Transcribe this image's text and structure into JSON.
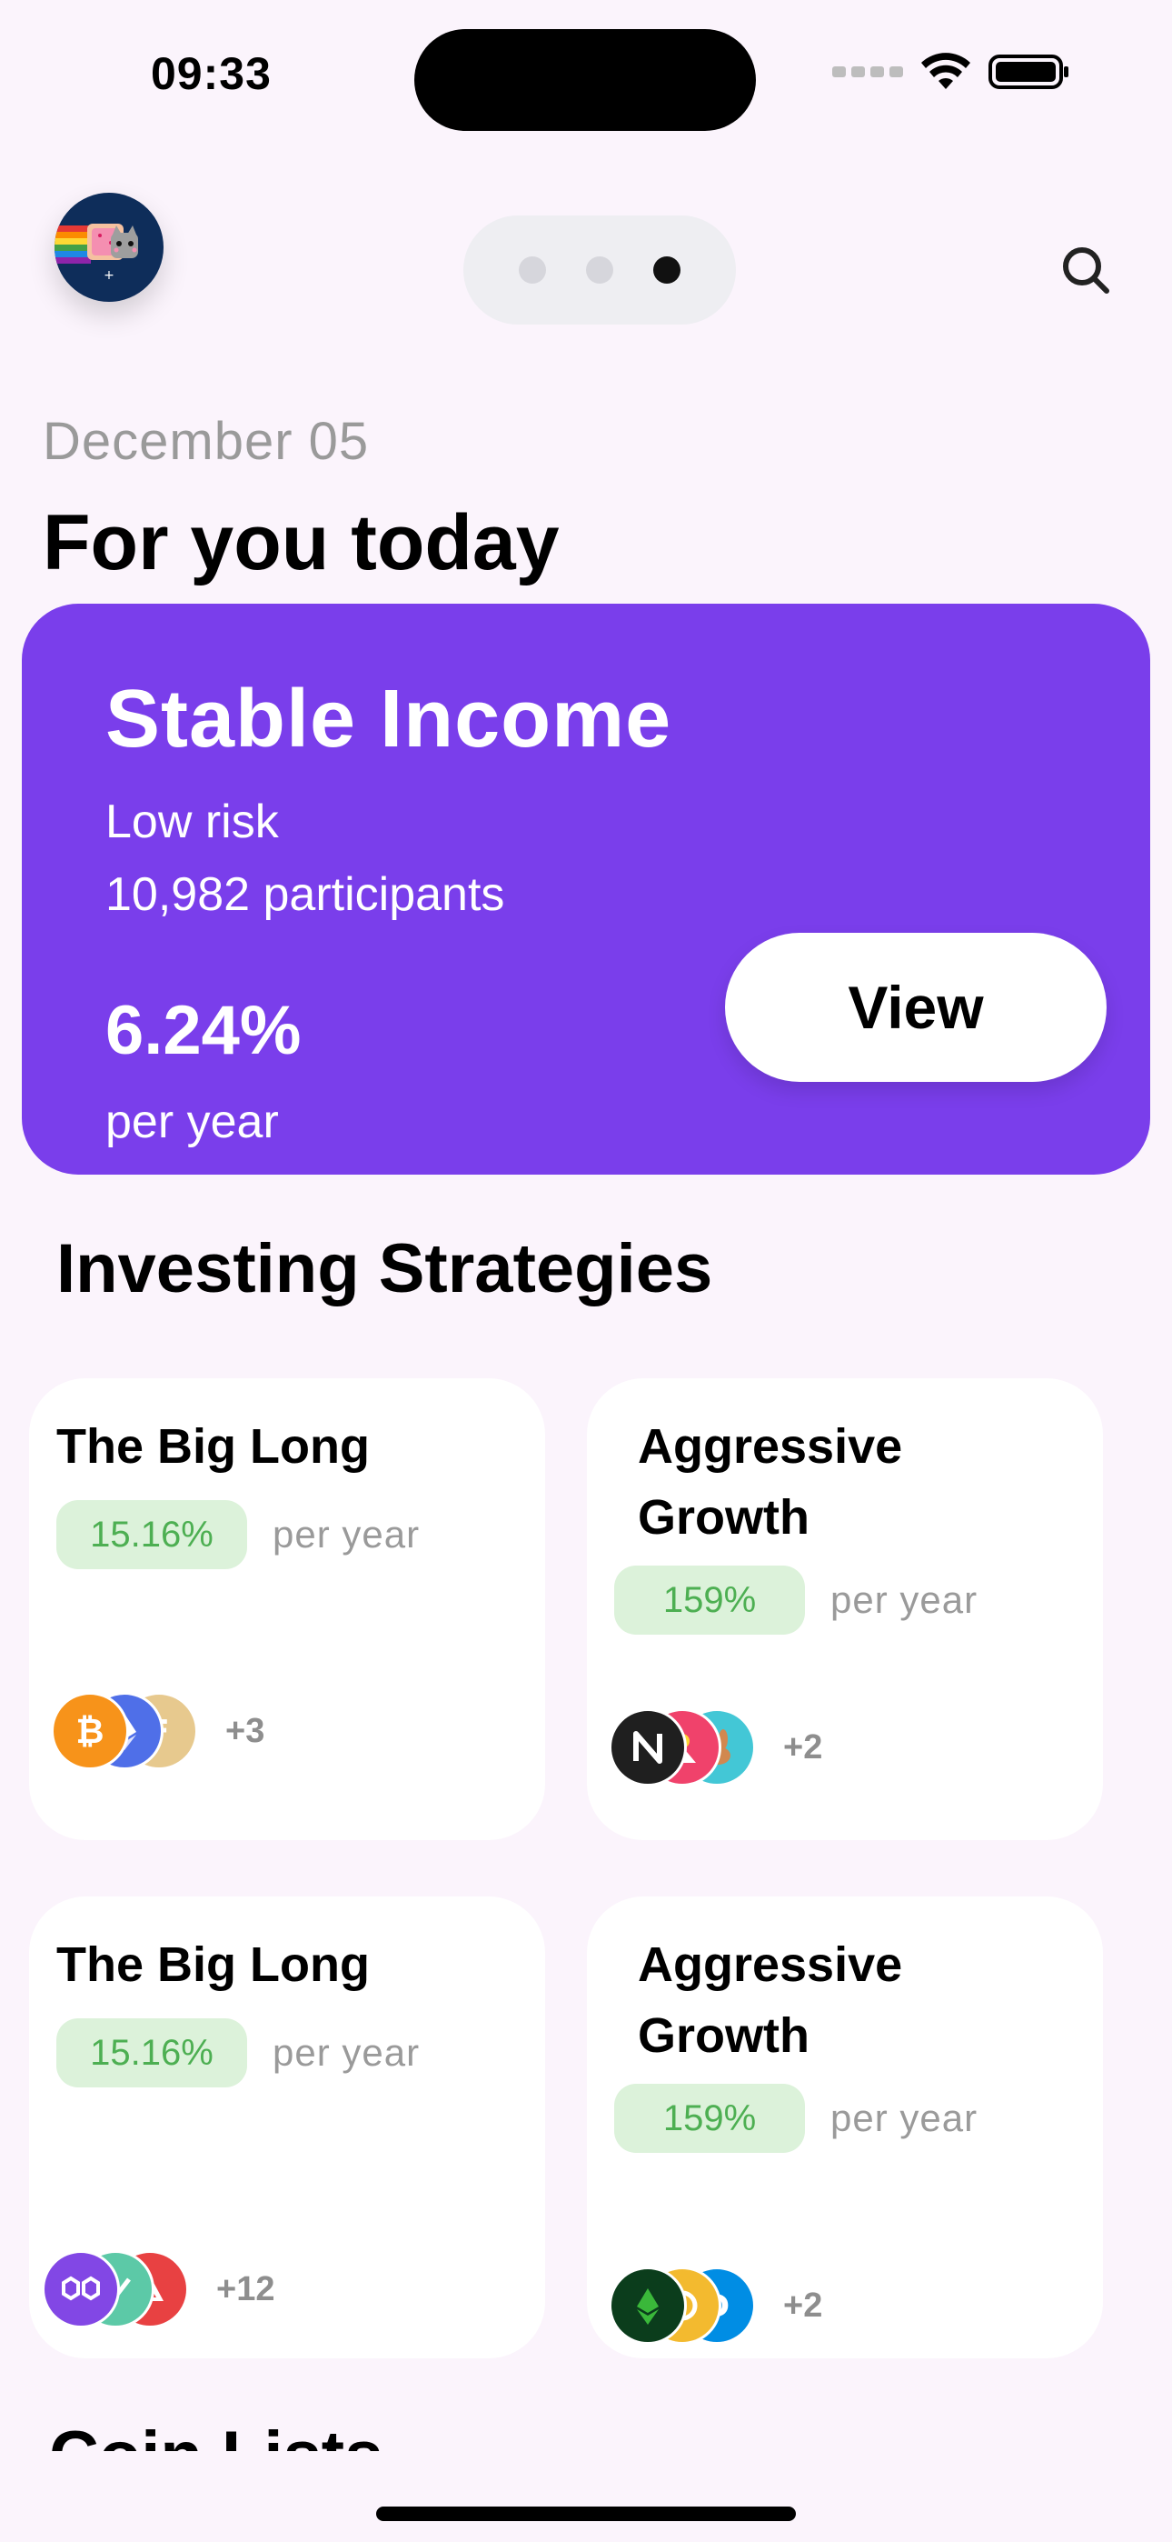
{
  "status_bar": {
    "time": "09:33"
  },
  "header": {
    "page_count": 3,
    "active_page_index": 2
  },
  "today": {
    "date": "December 05",
    "heading": "For you today"
  },
  "featured": {
    "title": "Stable Income",
    "risk": "Low risk",
    "participants": "10,982 participants",
    "rate": "6.24%",
    "period": "per year",
    "view_label": "View",
    "background_color": "#7A3EEB"
  },
  "strategies": {
    "heading": "Investing Strategies",
    "items": [
      {
        "title": "The Big Long",
        "rate": "15.16%",
        "period": "per year",
        "coins": [
          "bitcoin-icon",
          "ethereum-icon",
          "coin-f-icon"
        ],
        "more": "+3"
      },
      {
        "title": "Aggressive Growth",
        "rate": "159%",
        "period": "per year",
        "coins": [
          "near-icon",
          "coin-red-icon",
          "pancakeswap-icon"
        ],
        "more": "+2"
      },
      {
        "title": "The Big Long",
        "rate": "15.16%",
        "period": "per year",
        "coins": [
          "polygon-icon",
          "coin-teal-icon",
          "avalanche-icon"
        ],
        "more": "+12"
      },
      {
        "title": "Aggressive Growth",
        "rate": "159%",
        "period": "per year",
        "coins": [
          "ethereum-classic-icon",
          "coin-gold-icon",
          "dash-icon"
        ],
        "more": "+2"
      }
    ]
  },
  "coin_lists": {
    "heading": "Coin Lists"
  }
}
